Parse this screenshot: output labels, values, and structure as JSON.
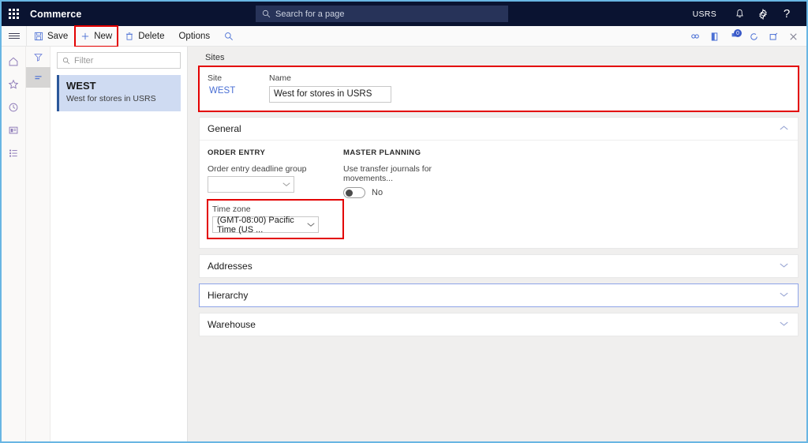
{
  "topbar": {
    "waffle_icon": "waffle-grid-icon",
    "brand": "Commerce",
    "search": {
      "placeholder": "Search for a page",
      "icon": "search-icon"
    },
    "company": "USRS",
    "icons": [
      "notifications-bell-icon",
      "settings-gear-icon",
      "help-question-icon"
    ]
  },
  "actionpane": {
    "hamburger_icon": "hamburger-menu-icon",
    "save_label": "Save",
    "new_label": "New",
    "delete_label": "Delete",
    "options_label": "Options",
    "search_icon": "search-icon",
    "right_icons": [
      "link-share-icon",
      "office-app-icon",
      "notification-flag-icon",
      "refresh-icon",
      "open-in-new-icon",
      "close-icon"
    ],
    "notification_count": "0"
  },
  "navrail": {
    "icons": [
      "home-icon",
      "favorites-star-icon",
      "recent-clock-icon",
      "workspace-card-icon",
      "modules-list-icon"
    ]
  },
  "listpane": {
    "filter_icon": "filter-funnel-icon",
    "list_icon": "list-lines-icon",
    "filter_placeholder": "Filter",
    "search_icon": "search-icon",
    "items": [
      {
        "title": "WEST",
        "subtitle": "West for stores in USRS"
      }
    ]
  },
  "main": {
    "caption": "Sites",
    "header_fields": {
      "site_label": "Site",
      "site_value": "WEST",
      "name_label": "Name",
      "name_value": "West for stores in USRS"
    },
    "sections": [
      {
        "title": "General",
        "expanded": true,
        "chevron": "chevron-up-icon",
        "groups": [
          {
            "title": "ORDER ENTRY",
            "field_label": "Order entry deadline group",
            "field_value": "",
            "tz_label": "Time zone",
            "tz_value": "(GMT-08:00) Pacific Time (US ..."
          },
          {
            "title": "MASTER PLANNING",
            "field_label": "Use transfer journals for movements...",
            "toggle_value": "No"
          }
        ]
      },
      {
        "title": "Addresses",
        "expanded": false,
        "chevron": "chevron-down-icon"
      },
      {
        "title": "Hierarchy",
        "expanded": false,
        "chevron": "chevron-down-icon"
      },
      {
        "title": "Warehouse",
        "expanded": false,
        "chevron": "chevron-down-icon"
      }
    ]
  },
  "colors": {
    "header_bg": "#0a1331",
    "accent_link": "#4a6fd4",
    "highlight_red": "#e30000",
    "list_selected": "#cfdbf2",
    "window_border": "#69b6e3"
  }
}
